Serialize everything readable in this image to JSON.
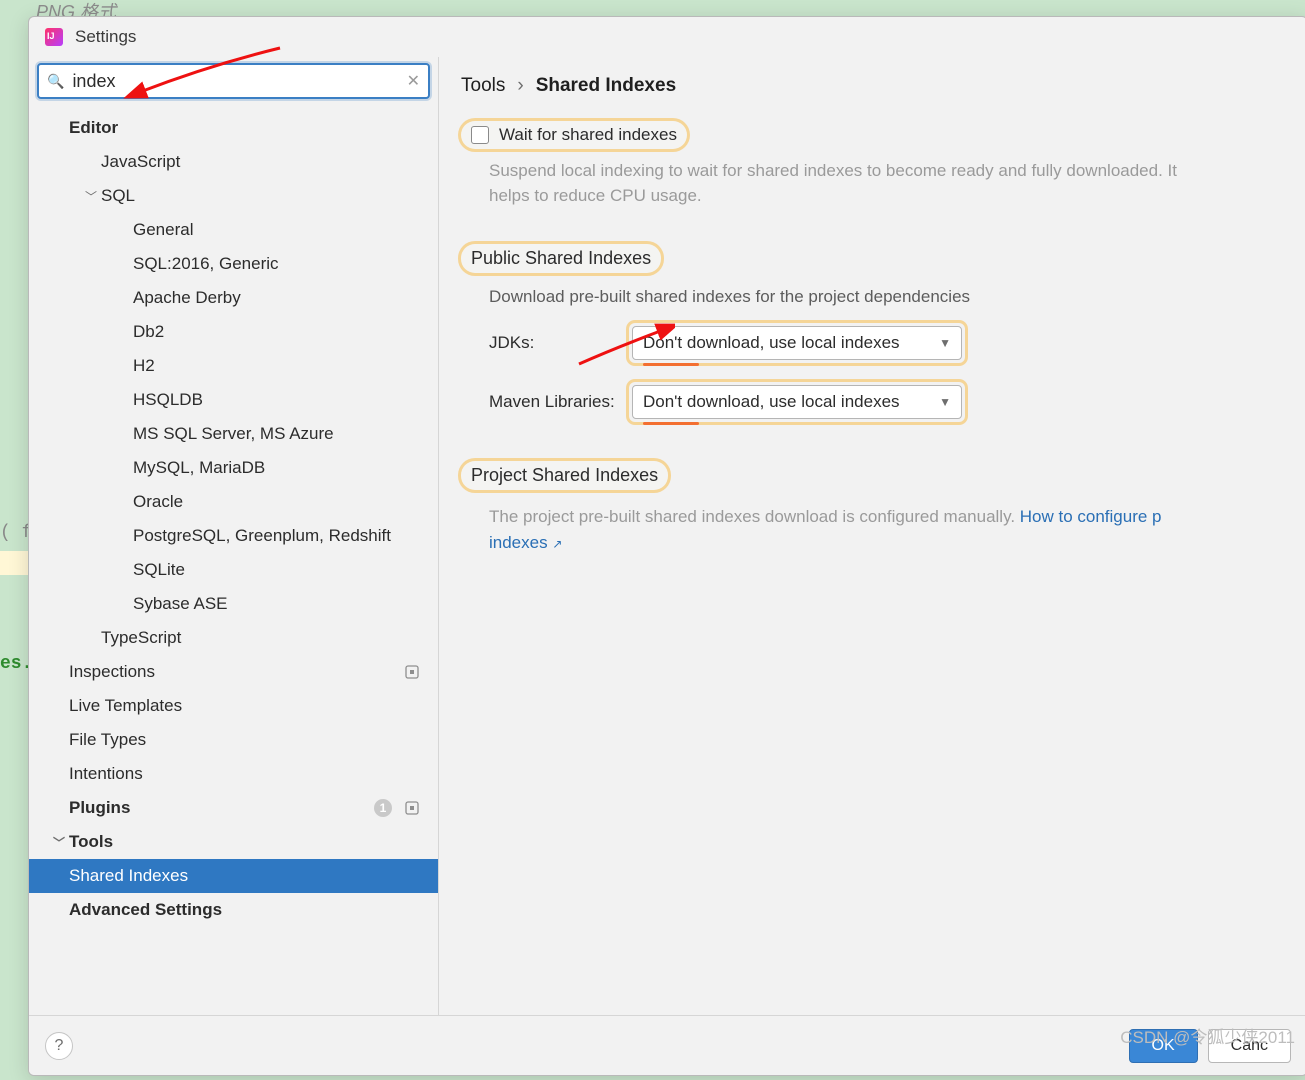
{
  "watermark": "CSDN @令狐少侠2011",
  "window": {
    "title": "Settings"
  },
  "search": {
    "value": "index",
    "placeholder": ""
  },
  "tree": {
    "editor": "Editor",
    "javascript": "JavaScript",
    "sql": "SQL",
    "sql_children": [
      "General",
      "SQL:2016, Generic",
      "Apache Derby",
      "Db2",
      "H2",
      "HSQLDB",
      "MS SQL Server, MS Azure",
      "MySQL, MariaDB",
      "Oracle",
      "PostgreSQL, Greenplum, Redshift",
      "SQLite",
      "Sybase ASE"
    ],
    "typescript": "TypeScript",
    "inspections": "Inspections",
    "live_templates": "Live Templates",
    "file_types": "File Types",
    "intentions": "Intentions",
    "plugins": "Plugins",
    "plugins_badge": "1",
    "tools": "Tools",
    "shared_indexes": "Shared Indexes",
    "advanced": "Advanced Settings"
  },
  "breadcrumb": {
    "root": "Tools",
    "sep": "›",
    "current": "Shared Indexes"
  },
  "wait_checkbox": {
    "label": "Wait for shared indexes",
    "desc": "Suspend local indexing to wait for shared indexes to become ready and fully downloaded. It helps to reduce CPU usage."
  },
  "public_section": {
    "title": "Public Shared Indexes",
    "desc": "Download pre-built shared indexes for the project dependencies",
    "jdk_label": "JDKs:",
    "jdk_value": "Don't download, use local indexes",
    "maven_label": "Maven Libraries:",
    "maven_value": "Don't download, use local indexes"
  },
  "project_section": {
    "title": "Project Shared Indexes",
    "desc_before": "The project pre-built shared indexes download is configured manually. ",
    "link": "How to configure p",
    "desc_after": "indexes",
    "ext": "↗"
  },
  "footer": {
    "ok": "OK",
    "cancel": "Canc"
  },
  "bg": {
    "frag1": "PNG 格式",
    "frag2": "( f",
    "frag3": "es."
  }
}
